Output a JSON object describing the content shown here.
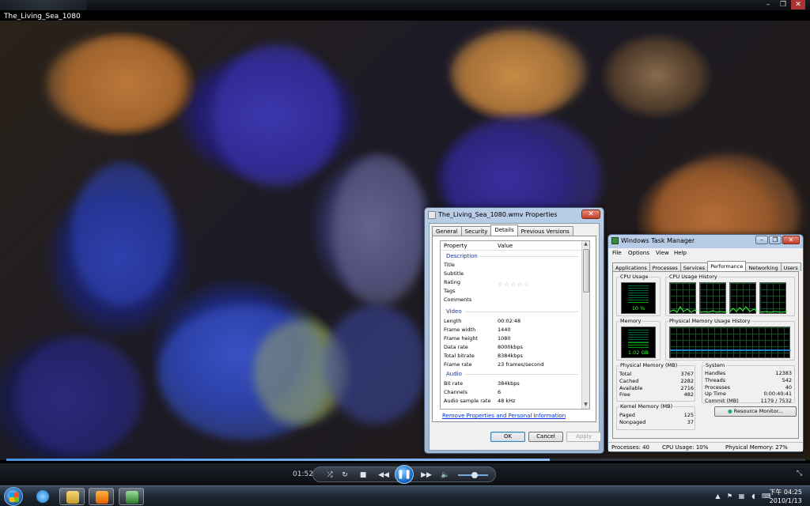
{
  "player": {
    "title": "The_Living_Sea_1080",
    "elapsed": "01:52",
    "progress": 0.68,
    "volume": 0.5
  },
  "properties_dialog": {
    "title": "The_Living_Sea_1080.wmv Properties",
    "tabs": [
      "General",
      "Security",
      "Details",
      "Previous Versions"
    ],
    "selected_tab": "Details",
    "columns": {
      "property": "Property",
      "value": "Value"
    },
    "sections": {
      "description": "Description",
      "video": "Video",
      "audio": "Audio"
    },
    "description_rows": [
      {
        "name": "Title",
        "value": ""
      },
      {
        "name": "Subtitle",
        "value": ""
      },
      {
        "name": "Rating",
        "value": ""
      },
      {
        "name": "Tags",
        "value": ""
      },
      {
        "name": "Comments",
        "value": ""
      }
    ],
    "rating_stars": "☆☆☆☆☆",
    "video_rows": [
      {
        "name": "Length",
        "value": "00:02:48"
      },
      {
        "name": "Frame width",
        "value": "1440"
      },
      {
        "name": "Frame height",
        "value": "1080"
      },
      {
        "name": "Data rate",
        "value": "8000kbps"
      },
      {
        "name": "Total bitrate",
        "value": "8384kbps"
      },
      {
        "name": "Frame rate",
        "value": "23 frames/second"
      }
    ],
    "audio_rows": [
      {
        "name": "Bit rate",
        "value": "384kbps"
      },
      {
        "name": "Channels",
        "value": "6"
      },
      {
        "name": "Audio sample rate",
        "value": "48 kHz"
      }
    ],
    "link": "Remove Properties and Personal Information",
    "buttons": {
      "ok": "OK",
      "cancel": "Cancel",
      "apply": "Apply"
    }
  },
  "task_manager": {
    "title": "Windows Task Manager",
    "menu": [
      "File",
      "Options",
      "View",
      "Help"
    ],
    "tabs": [
      "Applications",
      "Processes",
      "Services",
      "Performance",
      "Networking",
      "Users"
    ],
    "selected_tab": "Performance",
    "cpu_usage": {
      "label": "CPU Usage",
      "value": "10 %",
      "level": 0.1
    },
    "cpu_history_label": "CPU Usage History",
    "memory": {
      "label": "Memory",
      "value": "1.02 GB",
      "level": 0.27
    },
    "memory_history_label": "Physical Memory Usage History",
    "physical_memory": {
      "label": "Physical Memory (MB)",
      "rows": [
        {
          "name": "Total",
          "value": "3767"
        },
        {
          "name": "Cached",
          "value": "2282"
        },
        {
          "name": "Available",
          "value": "2716"
        },
        {
          "name": "Free",
          "value": "482"
        }
      ]
    },
    "system": {
      "label": "System",
      "rows": [
        {
          "name": "Handles",
          "value": "12383"
        },
        {
          "name": "Threads",
          "value": "542"
        },
        {
          "name": "Processes",
          "value": "40"
        },
        {
          "name": "Up Time",
          "value": "0:00:40:41"
        },
        {
          "name": "Commit (MB)",
          "value": "1179 / 7532"
        }
      ]
    },
    "kernel_memory": {
      "label": "Kernel Memory (MB)",
      "rows": [
        {
          "name": "Paged",
          "value": "125"
        },
        {
          "name": "Nonpaged",
          "value": "37"
        }
      ]
    },
    "resource_monitor": "Resource Monitor...",
    "status": {
      "processes": "Processes: 40",
      "cpu": "CPU Usage: 10%",
      "memory": "Physical Memory: 27%"
    }
  },
  "taskbar": {
    "clock_time": "下午 04:25",
    "clock_date": "2010/1/13",
    "pinned": [
      "ie-icon",
      "explorer-icon",
      "media-player-icon",
      "task-manager-icon"
    ]
  },
  "colors": {
    "accent": "#1d6fc6",
    "meter_green": "#00aa00",
    "link_blue": "#0033cc"
  }
}
